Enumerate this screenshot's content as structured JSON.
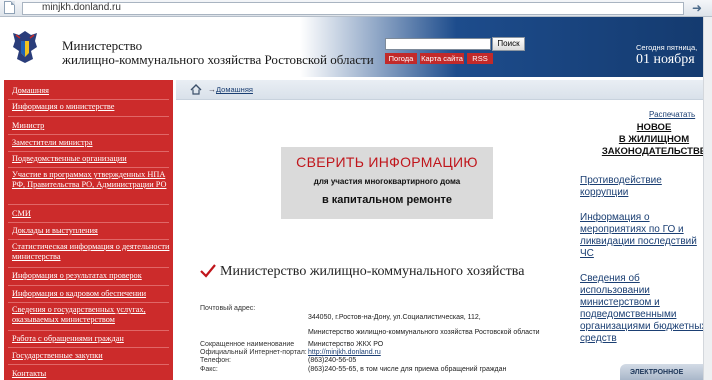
{
  "browser": {
    "url": "minjkh.donland.ru"
  },
  "header": {
    "title_line1": "Министерство",
    "title_line2": "жилищно-коммунального хозяйства Ростовской области",
    "search_button": "Поиск",
    "links": {
      "weather": "Погода",
      "sitemap": "Карта сайта",
      "rss": "RSS"
    },
    "date_line1": "Сегодня пятница,",
    "date_line2": "01 ноября"
  },
  "sidebar": {
    "items": [
      {
        "label": "Домашняя"
      },
      {
        "label": "Информация о министерстве"
      },
      {
        "label": "Министр"
      },
      {
        "label": "Заместители министра"
      },
      {
        "label": "Подведомственные организации"
      },
      {
        "label": "Участие в программах утвержденных НПА РФ, Правительства РО, Администрации РО"
      },
      {
        "label": "СМИ"
      },
      {
        "label": "Доклады и выступления"
      },
      {
        "label": "Статистическая информация о деятельности министерства"
      },
      {
        "label": "Информация о результатах проверок"
      },
      {
        "label": "Информация о кадровом обеспечении"
      },
      {
        "label": "Сведения о государственных услугах, оказываемых министерством"
      },
      {
        "label": "Работа с обращениями граждан"
      },
      {
        "label": "Государственные закупки"
      },
      {
        "label": "Контакты"
      }
    ]
  },
  "breadcrumb": {
    "separator": "→",
    "home": "Домашняя"
  },
  "main": {
    "print_link": "Распечатать",
    "banner": {
      "line1": "СВЕРИТЬ ИНФОРМАЦИЮ",
      "line2": "для участия многоквартирного дома",
      "line3": "в капитальном ремонте"
    },
    "section_title": "Министерство жилищно-коммунального хозяйства",
    "contacts": {
      "postal_label": "Почтовый адрес:",
      "postal_value": "344050, г.Ростов-на-Дону, ул.Социалистическая, 112,",
      "postal_value2": "Министерство жилищно-коммунального хозяйства Ростовской области",
      "short_label": "Сокращенное наименование",
      "short_value": "Министерство ЖКХ РО",
      "site_label": "Официальный Интернет-портал:",
      "site_value": "http://minjkh.donland.ru",
      "phone_label": "Телефон:",
      "phone_value": "(863)240-56-05",
      "fax_label": "Факс:",
      "fax_value": "(863)240-55-65, в том числе для приема обращений граждан"
    }
  },
  "right": {
    "news_heading_1": "НОВОЕ",
    "news_heading_2": "В ЖИЛИЩНОМ",
    "news_heading_3": "ЗАКОНОДАТЕЛЬСТВЕ",
    "links": [
      {
        "label": "Противодействие коррупции"
      },
      {
        "label": "Информация о мероприятиях по ГО и ликвидации последствий ЧС"
      },
      {
        "label": "Сведения об использовании министерством и подведомственными организациями бюджетных средств"
      }
    ],
    "bottom_box": "ЭЛЕКТРОННОЕ"
  },
  "colors": {
    "accent_red": "#cc2b2b",
    "header_blue": "#1d4c8c",
    "link_blue": "#1b3f73"
  }
}
